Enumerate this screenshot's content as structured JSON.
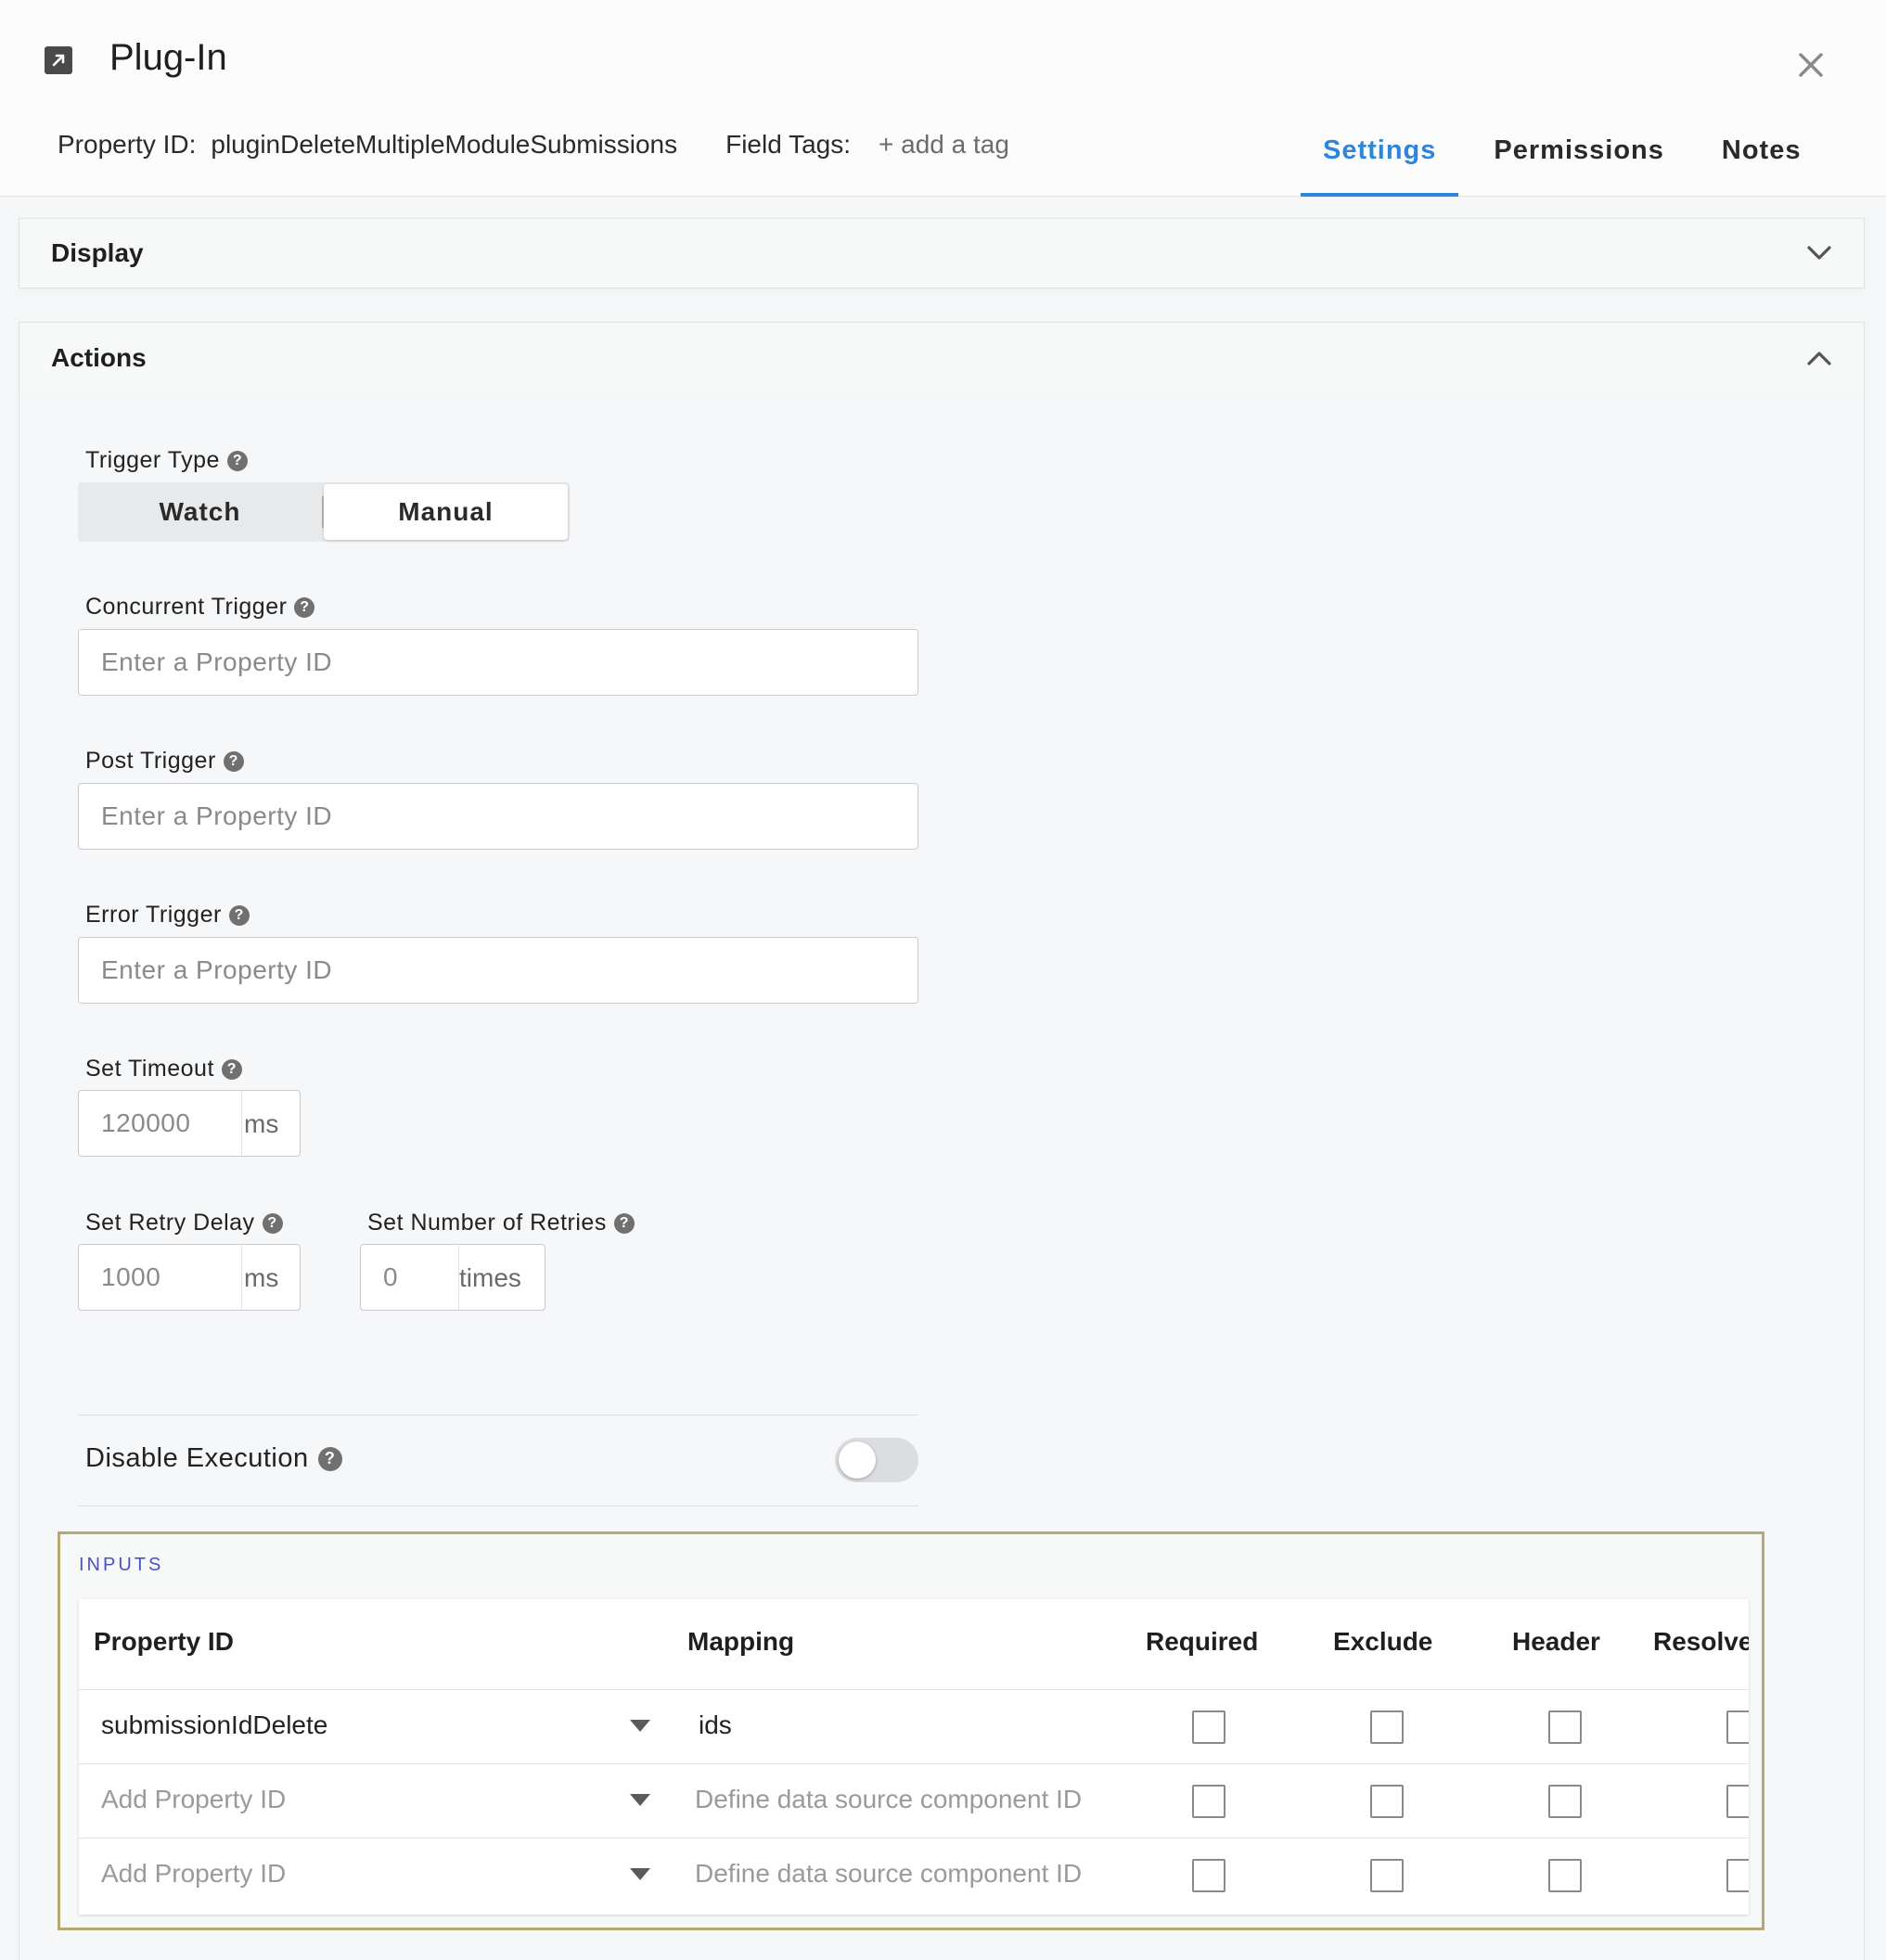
{
  "header": {
    "title": "Plug-In",
    "property_id_label": "Property ID:",
    "property_id_value": "pluginDeleteMultipleModuleSubmissions",
    "field_tags_label": "Field Tags:",
    "add_tag_label": "+ add a tag",
    "title_icon": "external-link-icon",
    "close_icon": "close-icon"
  },
  "tabs": [
    {
      "label": "Settings",
      "active": true
    },
    {
      "label": "Permissions",
      "active": false
    },
    {
      "label": "Notes",
      "active": false
    }
  ],
  "sections": {
    "display": {
      "title": "Display",
      "expanded": false
    },
    "actions": {
      "title": "Actions",
      "expanded": true
    }
  },
  "actions": {
    "trigger_type": {
      "label": "Trigger Type",
      "options": [
        "Watch",
        "Manual"
      ],
      "selected": "Manual"
    },
    "concurrent_trigger": {
      "label": "Concurrent Trigger",
      "placeholder": "Enter a Property ID"
    },
    "post_trigger": {
      "label": "Post Trigger",
      "placeholder": "Enter a Property ID"
    },
    "error_trigger": {
      "label": "Error Trigger",
      "placeholder": "Enter a Property ID"
    },
    "set_timeout": {
      "label": "Set Timeout",
      "value": "120000",
      "unit": "ms"
    },
    "set_retry_delay": {
      "label": "Set Retry Delay",
      "value": "1000",
      "unit": "ms"
    },
    "set_number_of_retries": {
      "label": "Set Number of Retries",
      "value": "0",
      "unit": "times"
    },
    "disable_execution": {
      "label": "Disable Execution",
      "enabled": false
    }
  },
  "inputs": {
    "title": "INPUTS",
    "columns": [
      "Property ID",
      "Mapping",
      "Required",
      "Exclude",
      "Header",
      "Resolve"
    ],
    "rows": [
      {
        "property_id": "submissionIdDelete",
        "mapping": "ids",
        "is_placeholder": false
      },
      {
        "property_id": "Add Property ID",
        "mapping": "Define data source component ID",
        "is_placeholder": true
      },
      {
        "property_id": "Add Property ID",
        "mapping": "Define data source component ID",
        "is_placeholder": true
      }
    ]
  },
  "colors": {
    "accent": "#2d86d9",
    "inputs_border": "#b8a774",
    "inputs_title": "#4a50c8"
  }
}
